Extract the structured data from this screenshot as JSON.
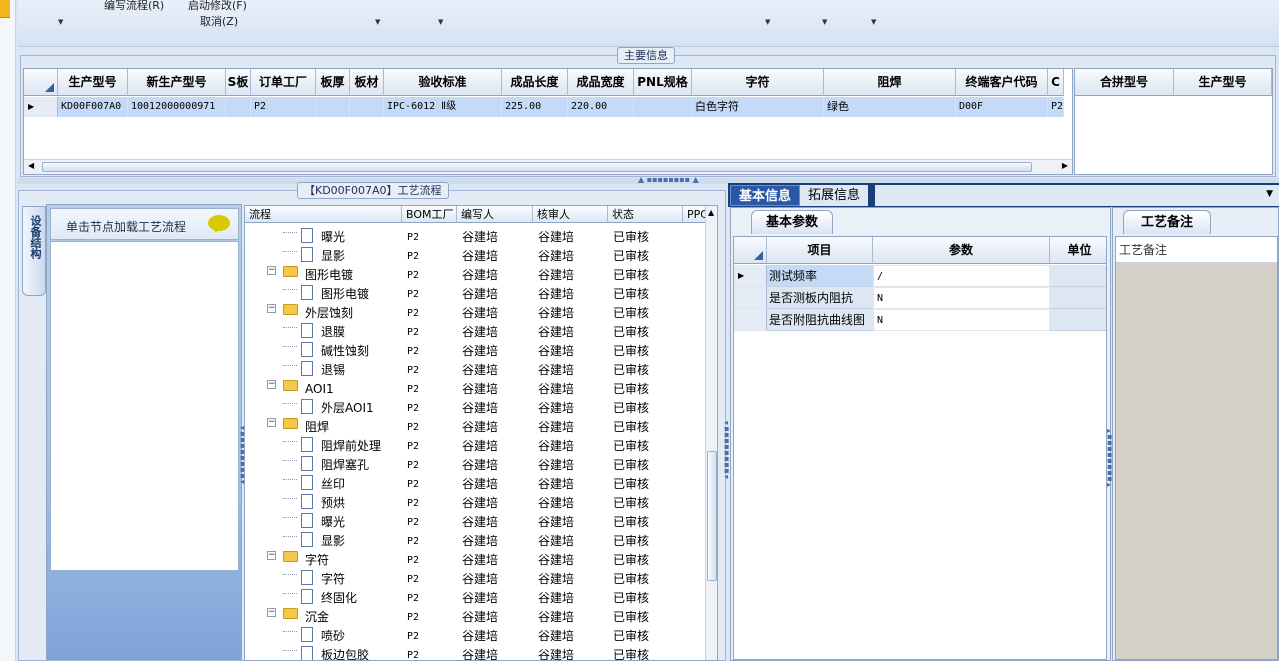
{
  "toolbar": {
    "menu1": "编写流程(R)",
    "menu2": "启动修改(F)",
    "menu3": "取消(Z)"
  },
  "main_info": {
    "legend": "主要信息",
    "columns": [
      "生产型号",
      "新生产型号",
      "S板",
      "订单工厂",
      "板厚",
      "板材",
      "验收标准",
      "成品长度",
      "成品宽度",
      "PNL规格",
      "字符",
      "阻焊",
      "终端客户代码",
      "C"
    ],
    "row": [
      "KD00F007A0",
      "10012000000971",
      "",
      "P2",
      "",
      "",
      "IPC-6012 Ⅱ级",
      "225.00",
      "220.00",
      "",
      "白色字符",
      "绿色",
      "D00F",
      "P2"
    ],
    "side_columns": [
      "合拼型号",
      "生产型号"
    ]
  },
  "left_panel": {
    "vertical_tab": "设备结构",
    "hint": "单击节点加载工艺流程"
  },
  "flow": {
    "legend": "【KD00F007A0】工艺流程",
    "columns": [
      "流程",
      "BOM工厂",
      "编写人",
      "核审人",
      "状态",
      "PPC"
    ],
    "rows": [
      {
        "name": "曝光",
        "type": "doc",
        "level": 2,
        "factory": "P2",
        "writer": "谷建培",
        "reviewer": "谷建培",
        "status": "已审核"
      },
      {
        "name": "显影",
        "type": "doc",
        "level": 2,
        "factory": "P2",
        "writer": "谷建培",
        "reviewer": "谷建培",
        "status": "已审核"
      },
      {
        "name": "图形电镀",
        "type": "folder",
        "level": 1,
        "factory": "P2",
        "writer": "谷建培",
        "reviewer": "谷建培",
        "status": "已审核"
      },
      {
        "name": "图形电镀",
        "type": "doc",
        "level": 2,
        "factory": "P2",
        "writer": "谷建培",
        "reviewer": "谷建培",
        "status": "已审核"
      },
      {
        "name": "外层蚀刻",
        "type": "folder",
        "level": 1,
        "factory": "P2",
        "writer": "谷建培",
        "reviewer": "谷建培",
        "status": "已审核"
      },
      {
        "name": "退膜",
        "type": "doc",
        "level": 2,
        "factory": "P2",
        "writer": "谷建培",
        "reviewer": "谷建培",
        "status": "已审核"
      },
      {
        "name": "碱性蚀刻",
        "type": "doc",
        "level": 2,
        "factory": "P2",
        "writer": "谷建培",
        "reviewer": "谷建培",
        "status": "已审核"
      },
      {
        "name": "退锡",
        "type": "doc",
        "level": 2,
        "factory": "P2",
        "writer": "谷建培",
        "reviewer": "谷建培",
        "status": "已审核"
      },
      {
        "name": "AOI1",
        "type": "folder",
        "level": 1,
        "factory": "P2",
        "writer": "谷建培",
        "reviewer": "谷建培",
        "status": "已审核"
      },
      {
        "name": "外层AOI1",
        "type": "doc",
        "level": 2,
        "factory": "P2",
        "writer": "谷建培",
        "reviewer": "谷建培",
        "status": "已审核"
      },
      {
        "name": "阻焊",
        "type": "folder",
        "level": 1,
        "factory": "P2",
        "writer": "谷建培",
        "reviewer": "谷建培",
        "status": "已审核"
      },
      {
        "name": "阻焊前处理",
        "type": "doc",
        "level": 2,
        "factory": "P2",
        "writer": "谷建培",
        "reviewer": "谷建培",
        "status": "已审核"
      },
      {
        "name": "阻焊塞孔",
        "type": "doc",
        "level": 2,
        "factory": "P2",
        "writer": "谷建培",
        "reviewer": "谷建培",
        "status": "已审核"
      },
      {
        "name": "丝印",
        "type": "doc",
        "level": 2,
        "factory": "P2",
        "writer": "谷建培",
        "reviewer": "谷建培",
        "status": "已审核"
      },
      {
        "name": "预烘",
        "type": "doc",
        "level": 2,
        "factory": "P2",
        "writer": "谷建培",
        "reviewer": "谷建培",
        "status": "已审核"
      },
      {
        "name": "曝光",
        "type": "doc",
        "level": 2,
        "factory": "P2",
        "writer": "谷建培",
        "reviewer": "谷建培",
        "status": "已审核"
      },
      {
        "name": "显影",
        "type": "doc",
        "level": 2,
        "factory": "P2",
        "writer": "谷建培",
        "reviewer": "谷建培",
        "status": "已审核"
      },
      {
        "name": "字符",
        "type": "folder",
        "level": 1,
        "factory": "P2",
        "writer": "谷建培",
        "reviewer": "谷建培",
        "status": "已审核"
      },
      {
        "name": "字符",
        "type": "doc",
        "level": 2,
        "factory": "P2",
        "writer": "谷建培",
        "reviewer": "谷建培",
        "status": "已审核"
      },
      {
        "name": "终固化",
        "type": "doc",
        "level": 2,
        "factory": "P2",
        "writer": "谷建培",
        "reviewer": "谷建培",
        "status": "已审核"
      },
      {
        "name": "沉金",
        "type": "folder",
        "level": 1,
        "factory": "P2",
        "writer": "谷建培",
        "reviewer": "谷建培",
        "status": "已审核"
      },
      {
        "name": "喷砂",
        "type": "doc",
        "level": 2,
        "factory": "P2",
        "writer": "谷建培",
        "reviewer": "谷建培",
        "status": "已审核"
      },
      {
        "name": "板边包胶",
        "type": "doc",
        "level": 2,
        "factory": "P2",
        "writer": "谷建培",
        "reviewer": "谷建培",
        "status": "已审核"
      }
    ]
  },
  "right": {
    "tabs": [
      "基本信息",
      "拓展信息"
    ],
    "subtab": "基本参数",
    "param_columns": [
      "项目",
      "参数",
      "单位"
    ],
    "params": [
      {
        "item": "测试频率",
        "value": "/"
      },
      {
        "item": "是否测板内阻抗",
        "value": "N"
      },
      {
        "item": "是否附阻抗曲线图",
        "value": "N"
      }
    ],
    "note_tab": "工艺备注",
    "note_header": "工艺备注"
  },
  "colors": {
    "selected_row": "#c4daf7",
    "active_tab": "#1a3d7c",
    "folder": "#f4c84a"
  }
}
